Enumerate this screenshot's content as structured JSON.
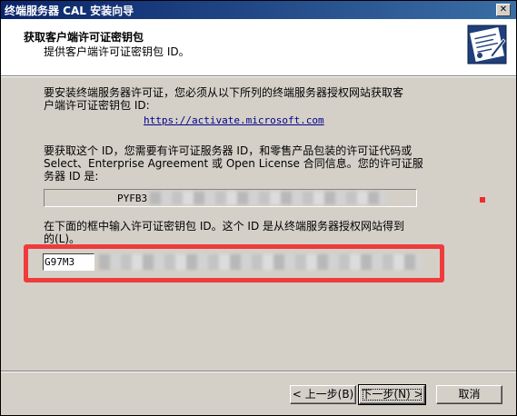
{
  "window": {
    "title": "终端服务器 CAL 安装向导",
    "close_glyph": "✕"
  },
  "header": {
    "title": "获取客户端许可证密钥包",
    "subtitle": "提供客户端许可证密钥包 ID。"
  },
  "body": {
    "intro_line1": "要安装终端服务器许可证，您必须从以下所列的终端服务器授权网站获取客",
    "intro_line2": "户端许可证密钥包 ID:",
    "url": "https://activate.microsoft.com",
    "info_line1": "要获取这个 ID，您需要有许可证服务器 ID，和零售产品包装的许可证代码或",
    "info_line2": "Select、Enterprise Agreement 或 Open License 合同信息。您的许可证服",
    "info_line3": "务器 ID 是:",
    "server_id_prefix": "PYFB3",
    "prompt_line1": "在下面的框中输入许可证密钥包 ID。这个 ID 是从终端服务器授权网站得到",
    "prompt_line2": "的(L)。",
    "key_first_segment": "G97M3"
  },
  "buttons": {
    "back": "< 上一步(B)",
    "next": "下一步(N) >",
    "cancel": "取消"
  },
  "colors": {
    "highlight_red": "#ef3b3b",
    "titlebar": "#0a246a",
    "link": "#00008b"
  },
  "icons": {
    "wizard": "license-certificate-icon",
    "close": "close-icon"
  }
}
